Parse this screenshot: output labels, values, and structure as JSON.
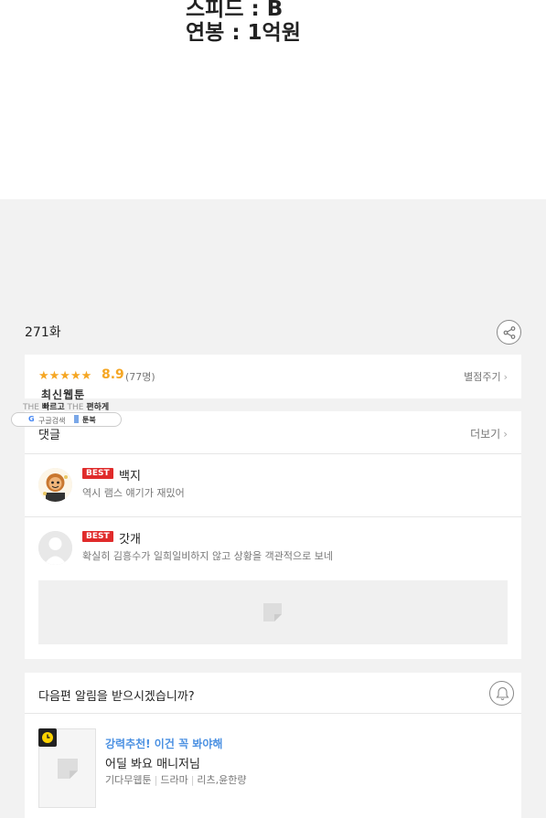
{
  "comic": {
    "line1": "스피드 : B",
    "line2": "연봉 : 1억원"
  },
  "episode": {
    "title": "271화",
    "share_icon": "share-icon"
  },
  "rating": {
    "stars": "★★★★★",
    "score": "8.9",
    "count": "(77명)",
    "rate_link": "별점주기",
    "stars_filled": 4.5,
    "star_color": "#f5a623"
  },
  "ad": {
    "latest_label": "최신웹툰",
    "tagline_the1": "THE",
    "tagline_fast": "빠르고",
    "tagline_the2": "THE",
    "tagline_easy": "편하게",
    "google_label": "구글검색",
    "toonbook_label": "툰북"
  },
  "comments": {
    "title": "댓글",
    "more": "더보기",
    "items": [
      {
        "badge": "BEST",
        "nick": "백지",
        "text": "역시 램스 얘기가 재밌어"
      },
      {
        "badge": "BEST",
        "nick": "갓개",
        "text": "확실히 김흥수가 일희일비하지 않고 상황을 객관적으로 보네"
      }
    ],
    "best_color": "#e02b2b"
  },
  "notify": {
    "title": "다음편 알림을 받으시겠습니까?",
    "recommend_label": "강력추천! 이건 꼭 봐야해",
    "recommend_title": "어딜 봐요 매니저님",
    "meta": [
      "기다무웹툰",
      "드라마",
      "리츠,윤한량"
    ],
    "accent_color": "#4a90e2"
  }
}
